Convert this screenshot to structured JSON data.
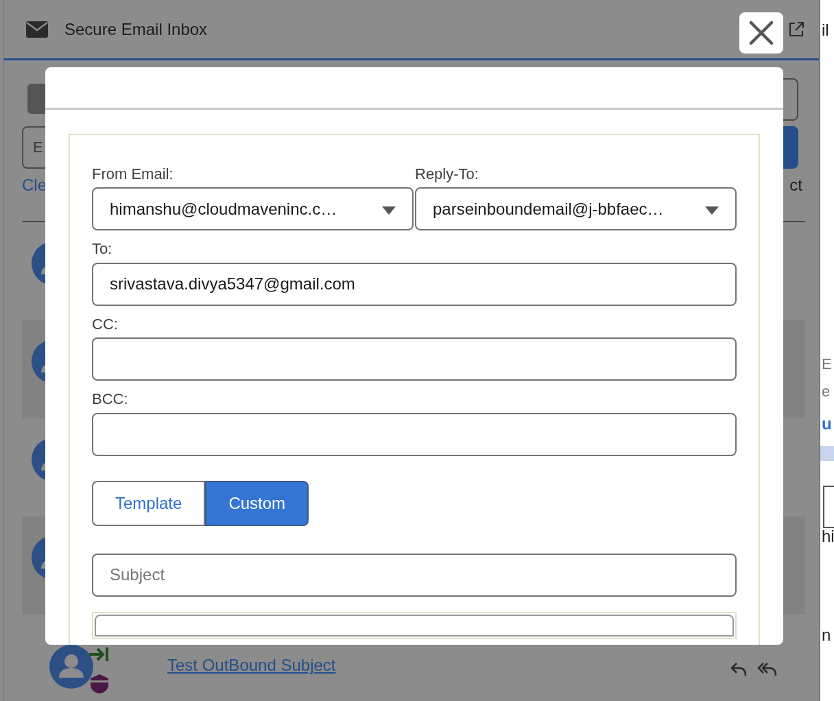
{
  "app": {
    "title": "Secure Email Inbox",
    "search": {
      "placeholder": "E"
    },
    "clear_link": "Cle",
    "select_label": "ct",
    "rows": [
      {
        "kind": "contact"
      },
      {
        "kind": "contact"
      },
      {
        "kind": "contact"
      },
      {
        "kind": "contact"
      },
      {
        "kind": "outbound",
        "subject": "Test OutBound Subject"
      }
    ]
  },
  "side_fragments": [
    {
      "text": "il",
      "kind": "text"
    },
    {
      "text": "E",
      "kind": "muted"
    },
    {
      "text": "e",
      "kind": "muted"
    },
    {
      "text": "u",
      "kind": "link"
    },
    {
      "text": "hi",
      "kind": "text"
    },
    {
      "text": "n",
      "kind": "text"
    }
  ],
  "modal": {
    "fields": [
      {
        "label": "From Email:",
        "kind": "select",
        "value": "himanshu@cloudmaveninc.c…"
      },
      {
        "label": "Reply-To:",
        "kind": "select",
        "value": "parseinboundemail@j-bbfaec…"
      },
      {
        "label": "To:",
        "kind": "input",
        "value": "srivastava.divya5347@gmail.com"
      },
      {
        "label": "CC:",
        "kind": "input"
      },
      {
        "label": "BCC:",
        "kind": "input"
      }
    ],
    "tabs": [
      {
        "label": "Template",
        "selected": false
      },
      {
        "label": "Custom",
        "selected": true
      }
    ],
    "subject": {
      "placeholder": "Subject"
    }
  }
}
